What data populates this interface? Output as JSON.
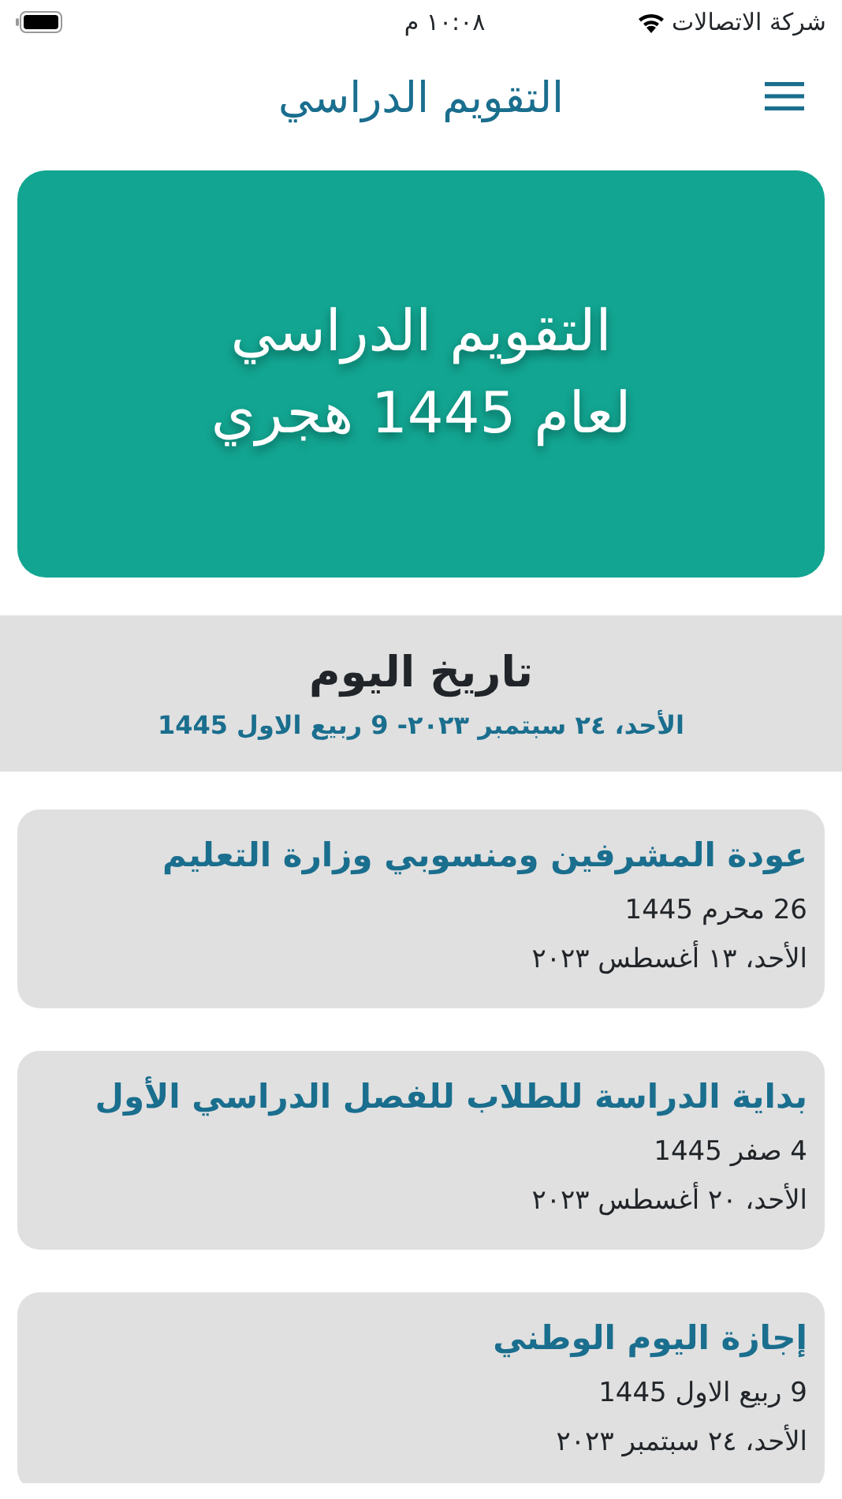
{
  "status_bar": {
    "carrier": "شركة الاتصالات",
    "time": "١٠:٠٨ م"
  },
  "header": {
    "title": "التقويم الدراسي"
  },
  "banner": {
    "lines": [
      "التقويم الدراسي",
      "لعام 1445 هجري"
    ]
  },
  "today": {
    "heading": "تاريخ اليوم",
    "date": "الأحد، ٢٤ سبتمبر ٢٠٢٣- 9 ربيع الاول 1445"
  },
  "events": [
    {
      "title": "عودة المشرفين ومنسوبي وزارة التعليم",
      "hijri": "26 محرم 1445",
      "gregorian": "الأحد، ١٣ أغسطس ٢٠٢٣"
    },
    {
      "title": "بداية الدراسة للطلاب للفصل الدراسي الأول",
      "hijri": "4 صفر 1445",
      "gregorian": "الأحد، ٢٠ أغسطس ٢٠٢٣"
    },
    {
      "title": "إجازة اليوم الوطني",
      "hijri": "9 ربيع الاول 1445",
      "gregorian": "الأحد، ٢٤ سبتمبر ٢٠٢٣"
    }
  ]
}
